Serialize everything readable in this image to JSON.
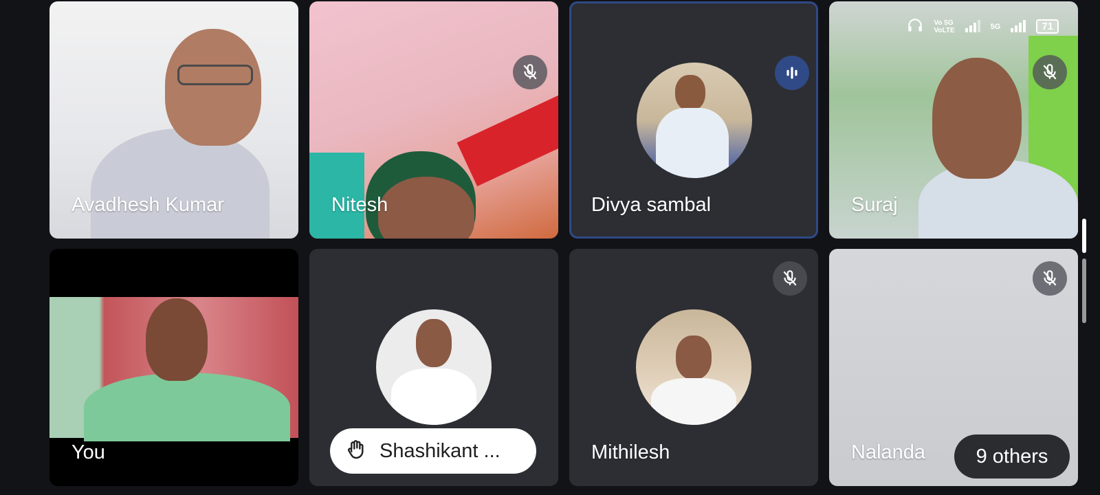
{
  "participants": [
    {
      "name": "Avadhesh Kumar",
      "video": true,
      "muted": false
    },
    {
      "name": "Nitesh",
      "video": true,
      "muted": true
    },
    {
      "name": "Divya sambal",
      "video": false,
      "muted": false,
      "speaking": true
    },
    {
      "name": "Suraj",
      "video": true,
      "muted": true
    },
    {
      "name": "You",
      "video": true,
      "muted": false
    },
    {
      "name": "Shashikant ...",
      "video": false,
      "hand_raised": true
    },
    {
      "name": "Mithilesh",
      "video": false,
      "muted": true
    },
    {
      "name": "Nalanda",
      "video": true,
      "muted": true
    }
  ],
  "others_label": "9 others",
  "status_bar": {
    "network_label": "Vo 5G\nVoLTE",
    "secondary_network": "5G",
    "battery": "71"
  },
  "colors": {
    "active_border": "#2f4a86",
    "tile_bg": "#2d2e33",
    "page_bg": "#121317"
  },
  "icons": {
    "mic_off": "mic-off-icon",
    "speaking": "speaking-indicator-icon",
    "hand": "raised-hand-icon"
  }
}
